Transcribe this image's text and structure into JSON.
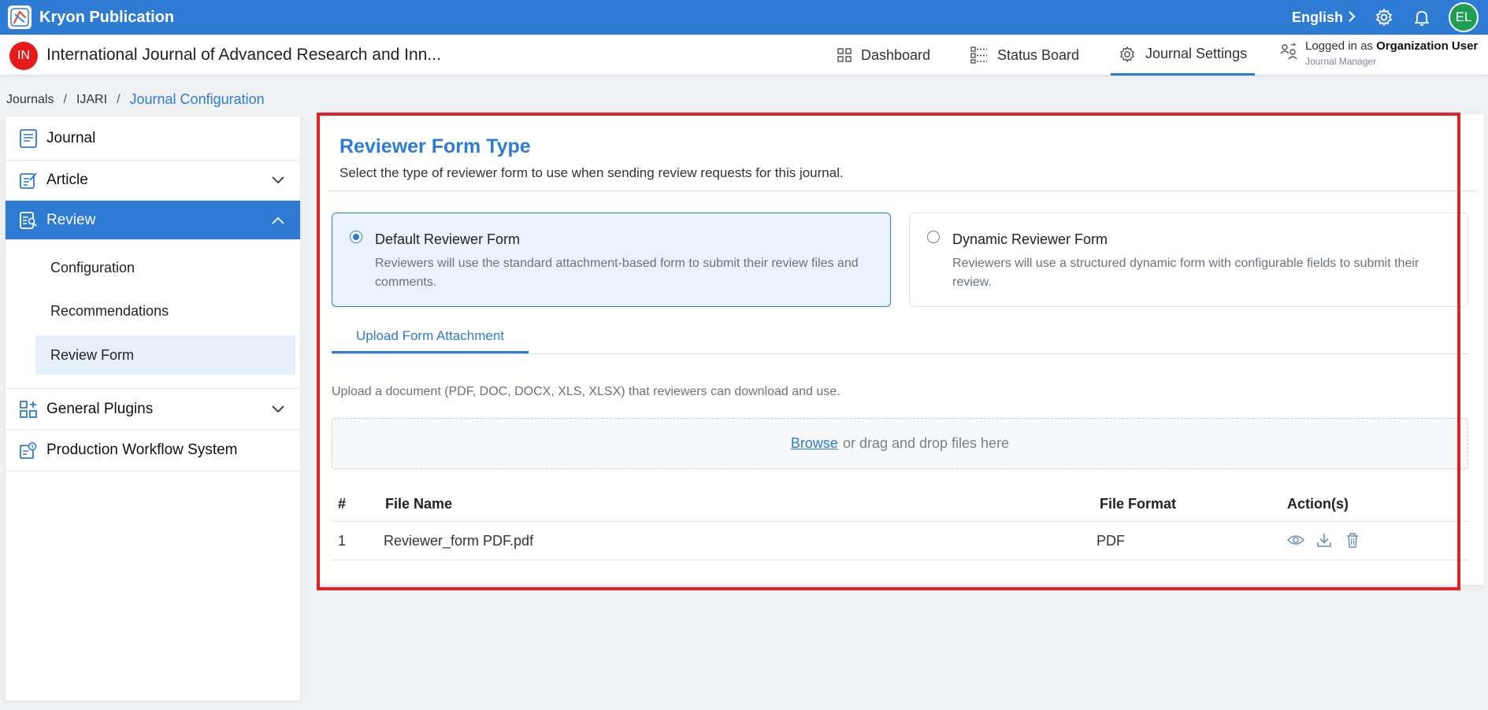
{
  "topbar": {
    "brand": "Kryon Publication",
    "language": "English",
    "avatar_initials": "EL",
    "accent": "#2e7bd3"
  },
  "header": {
    "journal_initials": "IN",
    "journal_title": "International Journal of Advanced Research and Inn...",
    "nav": [
      {
        "label": "Dashboard",
        "icon": "grid-icon"
      },
      {
        "label": "Status Board",
        "icon": "status-board-icon"
      },
      {
        "label": "Journal Settings",
        "icon": "gear-icon",
        "active": true
      }
    ],
    "login_prefix": "Logged in as",
    "login_user": "Organization User",
    "login_role": "Journal Manager"
  },
  "breadcrumb": [
    "Journals",
    "IJARI",
    "Journal Configuration"
  ],
  "sidebar": {
    "items": [
      {
        "label": "Journal",
        "icon": "journal-icon"
      },
      {
        "label": "Article",
        "icon": "article-icon"
      },
      {
        "label": "Review",
        "icon": "review-icon",
        "active": true
      },
      {
        "label": "General Plugins",
        "icon": "plugins-icon"
      },
      {
        "label": "Production Workflow System",
        "icon": "workflow-icon"
      }
    ],
    "review_sub": [
      "Configuration",
      "Recommendations",
      "Review Form"
    ]
  },
  "main": {
    "title": "Reviewer Form Type",
    "subtitle": "Select the type of reviewer form to use when sending review requests for this journal.",
    "options": [
      {
        "title": "Default Reviewer Form",
        "desc": "Reviewers will use the standard attachment-based form to submit their review files and comments.",
        "selected": true
      },
      {
        "title": "Dynamic Reviewer Form",
        "desc": "Reviewers will use a structured dynamic form with configurable fields to submit their review.",
        "selected": false
      }
    ],
    "tab_label": "Upload Form Attachment",
    "upload_help": "Upload a document (PDF, DOC, DOCX, XLS, XLSX) that reviewers can download and use.",
    "dropzone_browse": "Browse",
    "dropzone_text": "or drag and drop files here",
    "table": {
      "headers": [
        "#",
        "File Name",
        "File Format",
        "Action(s)"
      ],
      "rows": [
        {
          "num": "1",
          "name": "Reviewer_form PDF.pdf",
          "format": "PDF"
        }
      ]
    }
  }
}
